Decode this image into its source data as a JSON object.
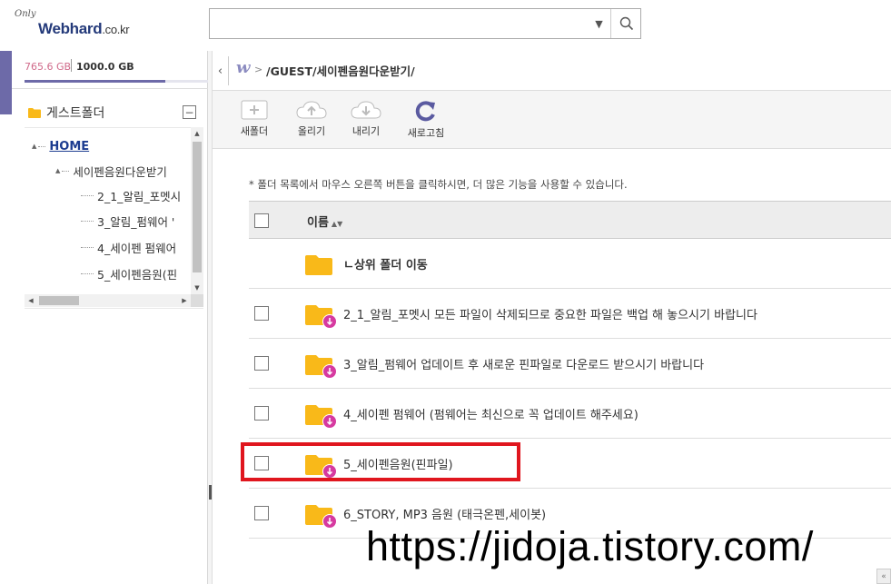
{
  "header": {
    "logo_only": "Only",
    "logo_brand": "Webhard",
    "logo_domain": ".co.kr",
    "search_value": ""
  },
  "sidebar": {
    "quota_used": "765.6 GB",
    "quota_total": "1000.0 GB",
    "quota_used_fraction": 0.7656,
    "folder_section_label": "게스트폴더",
    "collapse_symbol": "−",
    "tree": [
      {
        "label": "HOME"
      },
      {
        "label": "세이펜음원다운받기"
      },
      {
        "label": "2_1_알림_포멧시"
      },
      {
        "label": "3_알림_펌웨어 '"
      },
      {
        "label": "4_세이펜 펌웨어"
      },
      {
        "label": "5_세이펜음원(핀"
      }
    ]
  },
  "path": {
    "back_symbol": "‹",
    "separator": ">",
    "text": "/GUEST/세이펜음원다운받기/"
  },
  "toolbar": {
    "new_folder": "새폴더",
    "upload": "올리기",
    "download": "내리기",
    "refresh": "새로고침"
  },
  "main": {
    "hint": "* 폴더 목록에서 마우스 오른쪽 버튼을 클릭하시면, 더 많은 기능을 사용할 수 있습니다.",
    "column_name": "이름",
    "sort_symbol": "▲▼",
    "up_label": "ㄴ상위 폴더 이동",
    "rows": [
      {
        "name": "2_1_알림_포멧시 모든 파일이 삭제되므로 중요한 파일은 백업 해 놓으시기 바랍니다"
      },
      {
        "name": "3_알림_펌웨어 업데이트 후 새로운 핀파일로 다운로드 받으시기 바랍니다"
      },
      {
        "name": "4_세이펜 펌웨어 (펌웨어는 최신으로 꼭 업데이트 해주세요)"
      },
      {
        "name": "5_세이펜음원(핀파일)"
      },
      {
        "name": "6_STORY, MP3 음원 (태극온펜,세이봇)"
      }
    ]
  },
  "watermark": "https://jidoja.tistory.com/",
  "colors": {
    "accent": "#6d6aa8",
    "folder": "#f9b919",
    "download_badge": "#d63aa0",
    "highlight": "#e0161e"
  }
}
